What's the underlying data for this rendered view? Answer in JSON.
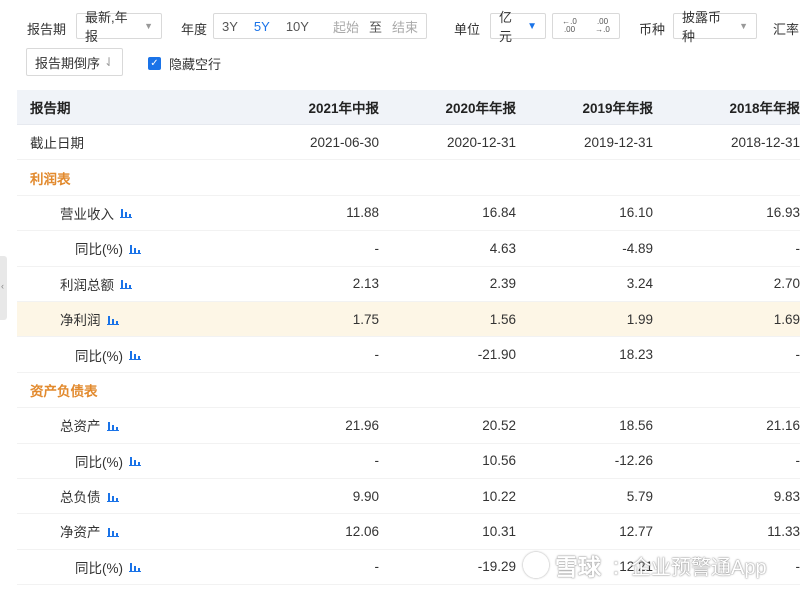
{
  "toolbar": {
    "period_label": "报告期",
    "period_value": "最新,年报",
    "year_label": "年度",
    "year_buttons": [
      "3Y",
      "5Y",
      "10Y"
    ],
    "year_active": "5Y",
    "start_placeholder": "起始",
    "to_label": "至",
    "end_placeholder": "结束",
    "unit_label": "单位",
    "unit_value": "亿元",
    "decimal_decrease": "←.0\n.00",
    "decimal_increase": ".00\n→.0",
    "currency_label": "币种",
    "currency_value": "披露币种",
    "fx_label": "汇率"
  },
  "toolbar2": {
    "sort_label": "报告期倒序",
    "sort_icon": "sort-arrows-icon",
    "hide_empty_label": "隐藏空行",
    "hide_empty_checked": true
  },
  "table": {
    "header": [
      "报告期",
      "2021年中报",
      "2020年年报",
      "2019年年报",
      "2018年年报"
    ],
    "rows": [
      {
        "label": "截止日期",
        "level": 0,
        "values": [
          "2021-06-30",
          "2020-12-31",
          "2019-12-31",
          "2018-12-31"
        ]
      },
      {
        "label": "利润表",
        "level": 0,
        "section": true,
        "values": [
          "",
          "",
          "",
          ""
        ]
      },
      {
        "label": "营业收入",
        "level": 1,
        "chart": true,
        "values": [
          "11.88",
          "16.84",
          "16.10",
          "16.93"
        ]
      },
      {
        "label": "同比(%)",
        "level": 2,
        "chart": true,
        "values": [
          "-",
          "4.63",
          "-4.89",
          "-"
        ]
      },
      {
        "label": "利润总额",
        "level": 1,
        "chart": true,
        "values": [
          "2.13",
          "2.39",
          "3.24",
          "2.70"
        ]
      },
      {
        "label": "净利润",
        "level": 1,
        "chart": true,
        "highlight": true,
        "values": [
          "1.75",
          "1.56",
          "1.99",
          "1.69"
        ]
      },
      {
        "label": "同比(%)",
        "level": 2,
        "chart": true,
        "values": [
          "-",
          "-21.90",
          "18.23",
          "-"
        ]
      },
      {
        "label": "资产负债表",
        "level": 0,
        "section": true,
        "values": [
          "",
          "",
          "",
          ""
        ]
      },
      {
        "label": "总资产",
        "level": 1,
        "chart": true,
        "values": [
          "21.96",
          "20.52",
          "18.56",
          "21.16"
        ]
      },
      {
        "label": "同比(%)",
        "level": 2,
        "chart": true,
        "values": [
          "-",
          "10.56",
          "-12.26",
          "-"
        ]
      },
      {
        "label": "总负债",
        "level": 1,
        "chart": true,
        "values": [
          "9.90",
          "10.22",
          "5.79",
          "9.83"
        ]
      },
      {
        "label": "净资产",
        "level": 1,
        "chart": true,
        "values": [
          "12.06",
          "10.31",
          "12.77",
          "11.33"
        ]
      },
      {
        "label": "同比(%)",
        "level": 2,
        "chart": true,
        "values": [
          "-",
          "-19.29",
          "12.21",
          "-"
        ]
      }
    ]
  },
  "watermark": {
    "brand": "雪球",
    "text": "：企业预警通App"
  },
  "colors": {
    "accent": "#1a73e8",
    "section": "#e28a2e",
    "header_bg": "#f0f3f8",
    "highlight_bg": "#fdf6e6"
  }
}
